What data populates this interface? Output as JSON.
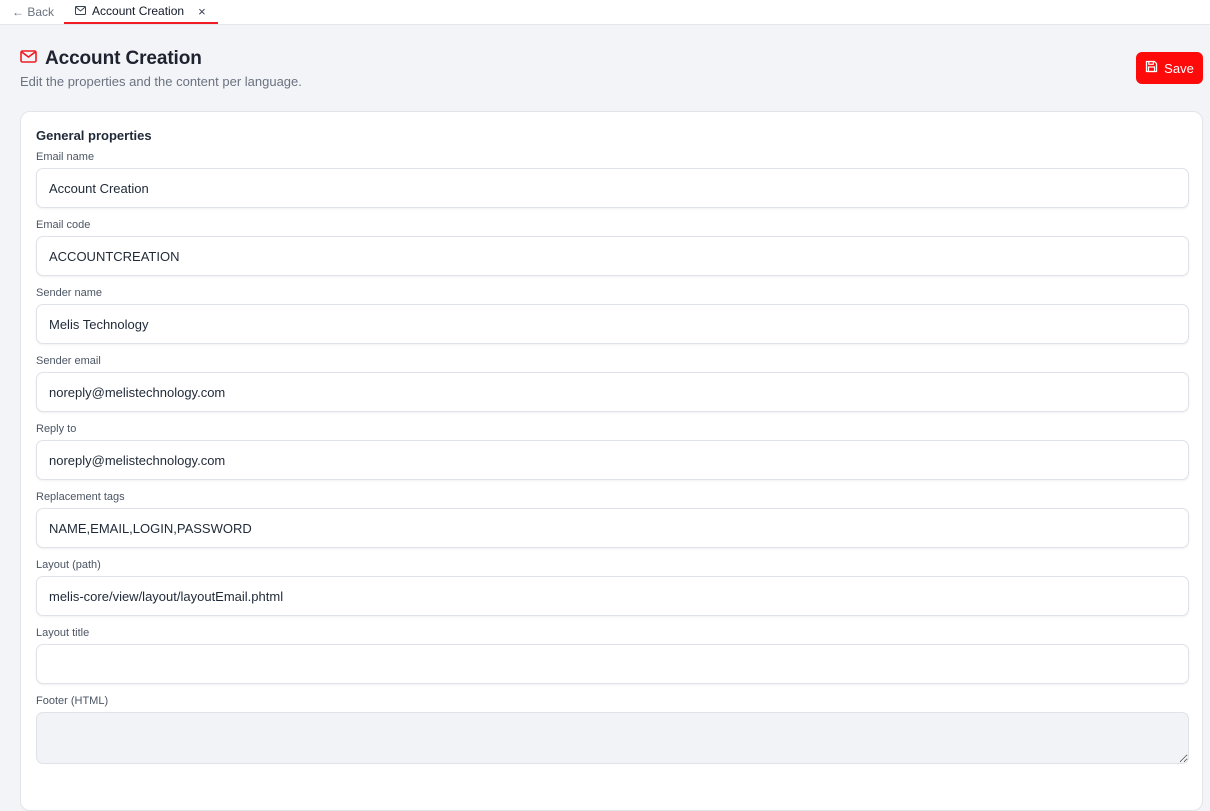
{
  "tabbar": {
    "back_label": "← Back",
    "tab_label": "Account Creation",
    "tab_icon": "mail-icon",
    "close_glyph": "×"
  },
  "header": {
    "title": "Account Creation",
    "subtitle": "Edit the properties and the content per language.",
    "title_icon": "mail-icon",
    "accent_color": "#ef1c25"
  },
  "toolbar": {
    "save_label": "Save",
    "save_icon": "floppy-disk-icon",
    "save_color": "#ff0a0a"
  },
  "form": {
    "section_title": "General properties",
    "fields": [
      {
        "label": "Email name",
        "value": "Account Creation"
      },
      {
        "label": "Email code",
        "value": "ACCOUNTCREATION"
      },
      {
        "label": "Sender name",
        "value": "Melis Technology"
      },
      {
        "label": "Sender email",
        "value": "noreply@melistechnology.com"
      },
      {
        "label": "Reply to",
        "value": "noreply@melistechnology.com"
      },
      {
        "label": "Replacement tags",
        "value": "NAME,EMAIL,LOGIN,PASSWORD"
      },
      {
        "label": "Layout (path)",
        "value": "melis-core/view/layout/layoutEmail.phtml"
      },
      {
        "label": "Layout title",
        "value": ""
      },
      {
        "label": "Footer (HTML)",
        "value": ""
      }
    ]
  }
}
